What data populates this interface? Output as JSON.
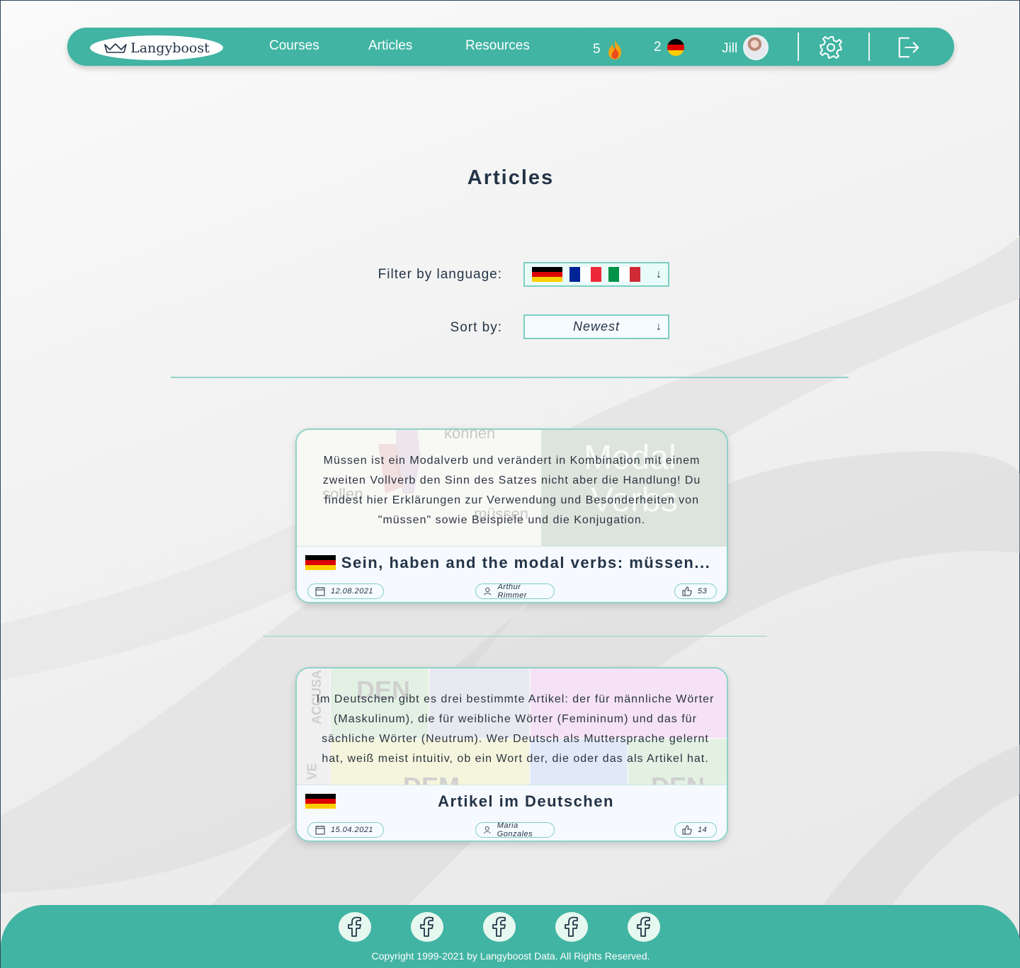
{
  "header": {
    "logo_text": "Langyboost",
    "nav": {
      "courses": "Courses",
      "articles": "Articles",
      "resources": "Resources"
    },
    "streak_count": "5",
    "language_count": "2",
    "user_name": "Jill",
    "icons": {
      "streak": "fire-icon",
      "settings": "gear-icon",
      "logout": "logout-icon"
    }
  },
  "main": {
    "title": "Articles",
    "filter_label": "Filter by language:",
    "filter_languages": [
      "de",
      "fr",
      "it"
    ],
    "sort_label": "Sort by:",
    "sort_value": "Newest"
  },
  "articles": [
    {
      "description": "Müssen ist ein Modalverb und verändert in Kombination mit einem zweiten Vollverb den Sinn des Satzes nicht aber die Handlung! Du findest hier Erklärungen zur Verwendung und Besonderheiten von \"müssen\" sowie Beispiele und die Konjugation.",
      "image_words": {
        "w1": "können",
        "w2": "sollen",
        "w3": "müssen",
        "w4": "Modal",
        "w5": "Verbs"
      },
      "language": "de",
      "title": "Sein, haben and the modal verbs: müssen...",
      "date": "12.08.2021",
      "author": "Arthur Rimmer",
      "likes": "53"
    },
    {
      "description": "Im Deutschen gibt es drei bestimmte Artikel: der für männliche Wörter (Maskulinum), die für weibliche Wörter (Femininum) und das für sächliche Wörter (Neutrum). Wer Deutsch als Muttersprache gelernt hat, weiß meist intuitiv, ob ein Wort der, die oder das als Artikel hat.",
      "image_words": {
        "w1": "DEN",
        "w2": "DEM",
        "w3": "DEN",
        "w4": "ACCUSA",
        "w5": "VE"
      },
      "language": "de",
      "title": "Artikel im Deutschen",
      "date": "15.04.2021",
      "author": "Maria Gonzales",
      "likes": "14"
    }
  ],
  "footer": {
    "social_icons": [
      "facebook-icon",
      "facebook-icon",
      "facebook-icon",
      "facebook-icon",
      "facebook-icon"
    ],
    "copyright": "Copyright 1999-2021 by Langyboost Data. All Rights Reserved."
  },
  "colors": {
    "brand": "#41b4a3",
    "accent_border": "#8fd3c8",
    "text": "#243447"
  }
}
